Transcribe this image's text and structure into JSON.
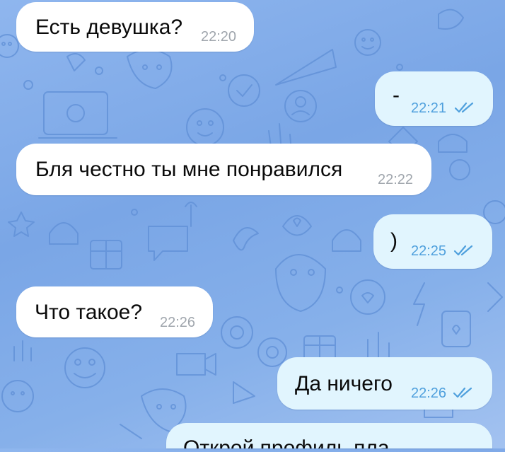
{
  "chat": {
    "messages": [
      {
        "direction": "incoming",
        "text": "Есть девушка?",
        "time": "22:20"
      },
      {
        "direction": "outgoing",
        "text": "-",
        "time": "22:21",
        "status": "read"
      },
      {
        "direction": "incoming",
        "text": "Бля честно ты мне понравился",
        "time": "22:22"
      },
      {
        "direction": "outgoing",
        "text": ")",
        "time": "22:25",
        "status": "read"
      },
      {
        "direction": "incoming",
        "text": "Что такое?",
        "time": "22:26"
      },
      {
        "direction": "outgoing",
        "text": "Да ничего",
        "time": "22:26",
        "status": "read"
      },
      {
        "direction": "outgoing",
        "text": "Открой профиль пла",
        "time": "",
        "status": "partial"
      }
    ]
  },
  "theme": {
    "wallpaper": "#84aeea",
    "incoming_bubble": "#ffffff",
    "outgoing_bubble": "#e1f5fe",
    "read_tick_color": "#4fa0dd"
  }
}
